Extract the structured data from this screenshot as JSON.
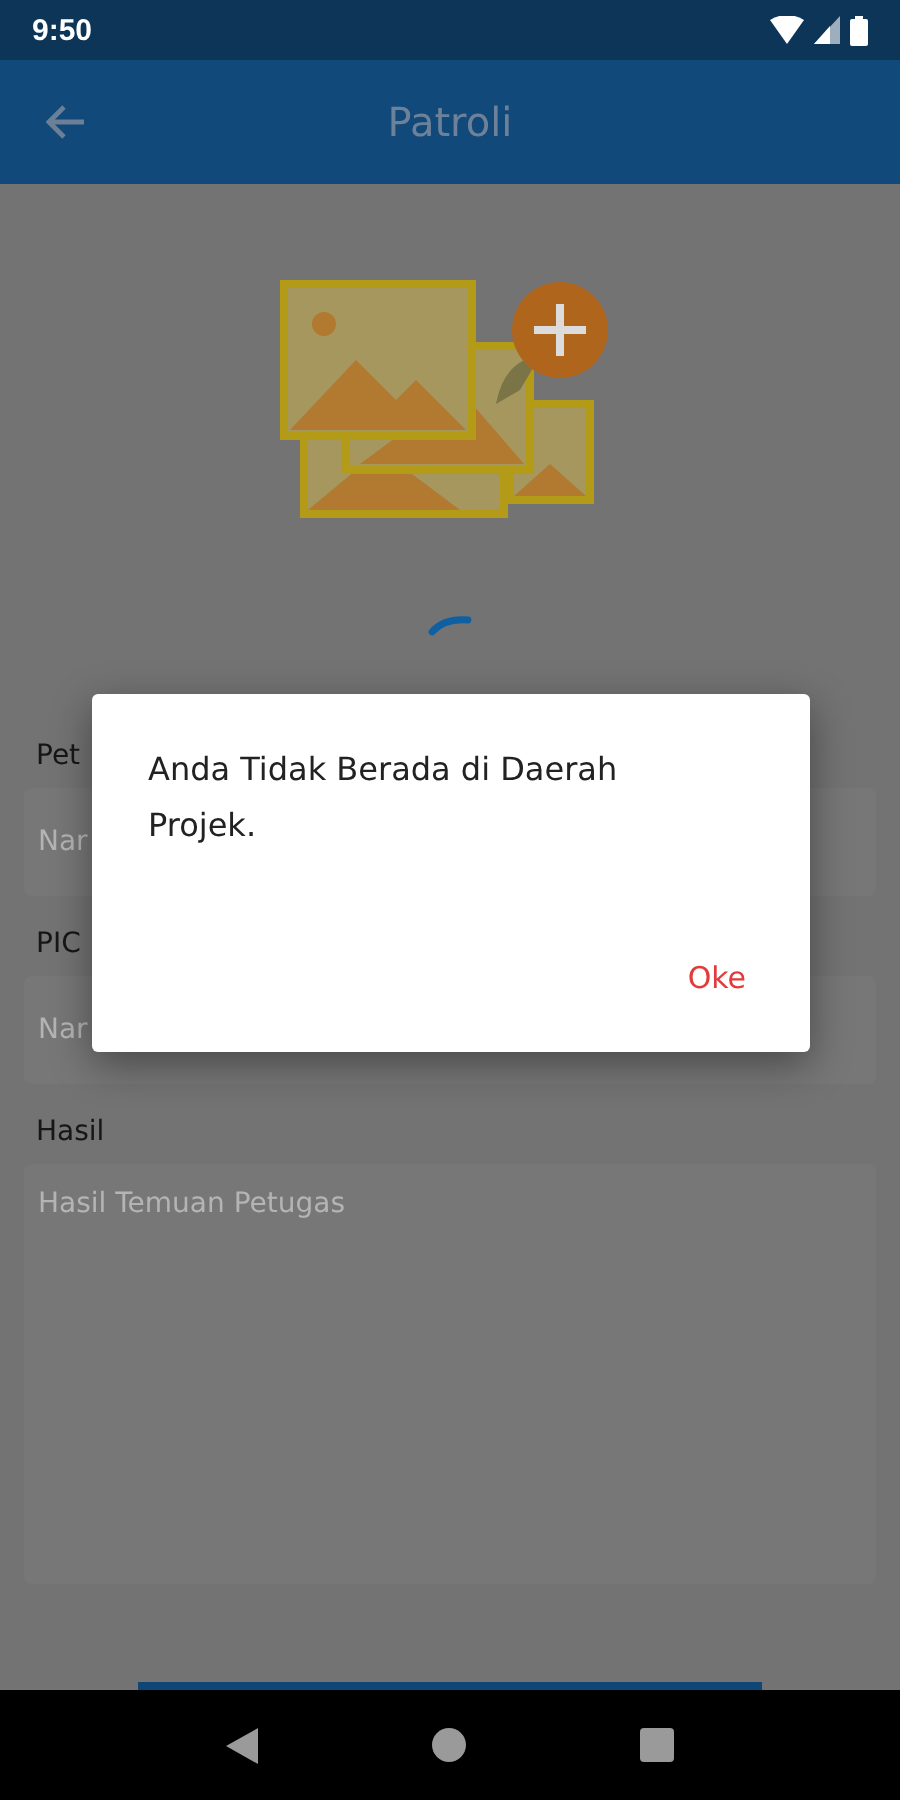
{
  "status_bar": {
    "time": "9:50"
  },
  "app_bar": {
    "title": "Patroli"
  },
  "loading": true,
  "form": {
    "fields": [
      {
        "label": "Pet",
        "placeholder": "Nar",
        "kind": "input"
      },
      {
        "label": "PIC",
        "placeholder": "Nar",
        "kind": "input"
      },
      {
        "label": "Hasil",
        "placeholder": "Hasil Temuan Petugas",
        "kind": "textarea"
      }
    ]
  },
  "dialog": {
    "message": "Anda Tidak Berada di Daerah Projek.",
    "button": "Oke"
  }
}
